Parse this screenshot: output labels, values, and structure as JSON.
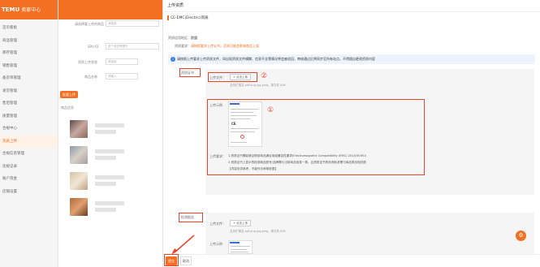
{
  "sidebar": {
    "brand": "TEMU",
    "brand_sub": "卖家中心",
    "items": [
      {
        "label": "首页看板"
      },
      {
        "label": "商品管理"
      },
      {
        "label": "库存管理"
      },
      {
        "label": "销售管理"
      },
      {
        "label": "备货单管理"
      },
      {
        "label": "发货管理"
      },
      {
        "label": "售后管理"
      },
      {
        "label": "质量管理"
      },
      {
        "label": "合规中心"
      },
      {
        "label": "资质上传"
      },
      {
        "label": "合规信息管理"
      },
      {
        "label": "违规记录"
      },
      {
        "label": "账户资金"
      },
      {
        "label": "店铺设置"
      }
    ]
  },
  "background": {
    "f1_label": "请选择要上传的商品",
    "f1_value": "请选择",
    "f2_label": "SPU ID",
    "f2_value": "多个用逗号隔开",
    "f3_label": "资质上传状态",
    "f3_value": "请选择",
    "f4_label": "商品名称",
    "f4_value": "请输入",
    "btn": "批量上传",
    "col": "商品信息"
  },
  "drawer": {
    "title": "上传资质",
    "cert_title": "CE-EMC(Electric)资质",
    "region_label": "资质适用地区：",
    "region_value": "欧盟",
    "req_label": "资质要求：",
    "req_value": "请按照要求上传证书，否则可能会影响商品上架",
    "notice": "请按照上传要求上传资质文件，如出现资质文件模糊、信息不全等情况将会被驳回，审核通过后将同步至所有站点，不得擅自更改资质内容",
    "section1": "资质证书",
    "section2": "检测报告",
    "upload_label": "上传文件：",
    "upload_button": "+ 点击上传",
    "upload_hint": "支持扩展名.pdf.png.jpg.jpeg，单文件10M",
    "example_label": "上传示例",
    "require_label": "上传要求：",
    "req_lines": [
      "1.资质证书需能够证明该商品满足电磁兼容性要求(Electromagnetic Compatibility (EMC) 2014/30/EU)",
      "2.资质证书上显示的检测商品型号/品牌需与当前商品信息一致，且资质证书的检测标准需与商品类目相匹配",
      "【内容仅供参考，不能作为审核依据】"
    ],
    "save_button": "提交",
    "cancel_button": "取消"
  },
  "annotations": {
    "one": "①",
    "two": "②"
  },
  "colors": {
    "accent": "#f36f21",
    "annotation": "#e8442e",
    "info": "#3b7ddd"
  },
  "fab_icon": "gear-icon"
}
